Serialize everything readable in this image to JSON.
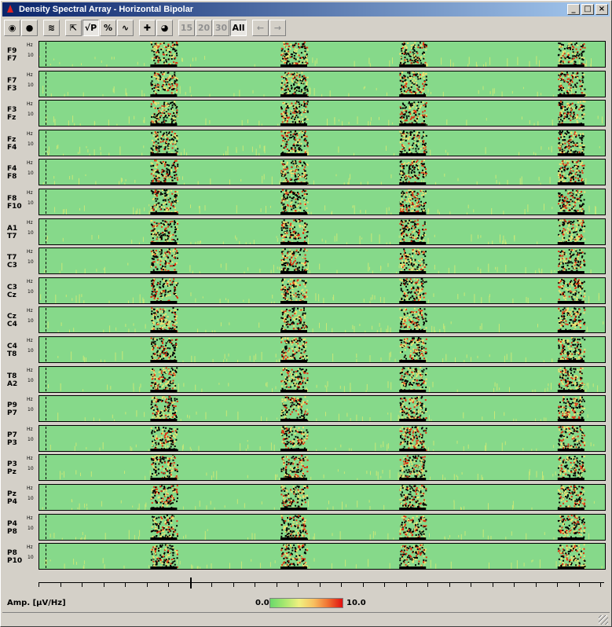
{
  "window": {
    "title": "Density Spectral Array - Horizontal Bipolar",
    "min_glyph": "_",
    "max_glyph": "□",
    "close_glyph": "×"
  },
  "toolbar": {
    "buttons": [
      {
        "name": "brain-view-button",
        "glyph": "◉",
        "state": "normal"
      },
      {
        "name": "topo-map-button",
        "glyph": "●",
        "state": "normal"
      },
      {
        "name": "waveform-button",
        "glyph": "≋",
        "state": "normal"
      },
      {
        "name": "fit-button",
        "glyph": "⇱",
        "state": "normal"
      },
      {
        "name": "sqrt-power-button",
        "glyph": "√P",
        "state": "pressed"
      },
      {
        "name": "percent-button",
        "glyph": "%",
        "state": "normal"
      },
      {
        "name": "trend-button",
        "glyph": "∿",
        "state": "normal"
      },
      {
        "name": "color-scale-button",
        "glyph": "✚",
        "state": "normal"
      },
      {
        "name": "head-map-button",
        "glyph": "◕",
        "state": "normal"
      },
      {
        "name": "range-15-button",
        "glyph": "15",
        "state": "disabled"
      },
      {
        "name": "range-20-button",
        "glyph": "20",
        "state": "disabled"
      },
      {
        "name": "range-30-button",
        "glyph": "30",
        "state": "disabled"
      },
      {
        "name": "range-all-button",
        "glyph": "All",
        "state": "pressed"
      },
      {
        "name": "back-button",
        "glyph": "←",
        "state": "disabled"
      },
      {
        "name": "forward-button",
        "glyph": "→",
        "state": "disabled"
      }
    ]
  },
  "axis": {
    "hz_label": "Hz",
    "ten_label": "10"
  },
  "channels": [
    [
      "F9",
      "F7"
    ],
    [
      "F7",
      "F3"
    ],
    [
      "F3",
      "Fz"
    ],
    [
      "Fz",
      "F4"
    ],
    [
      "F4",
      "F8"
    ],
    [
      "F8",
      "F10"
    ],
    [
      "A1",
      "T7"
    ],
    [
      "T7",
      "C3"
    ],
    [
      "C3",
      "Cz"
    ],
    [
      "Cz",
      "C4"
    ],
    [
      "C4",
      "T8"
    ],
    [
      "T8",
      "A2"
    ],
    [
      "P9",
      "P7"
    ],
    [
      "P7",
      "P3"
    ],
    [
      "P3",
      "Pz"
    ],
    [
      "Pz",
      "P4"
    ],
    [
      "P4",
      "P8"
    ],
    [
      "P8",
      "P10"
    ]
  ],
  "bursts": [
    0.22,
    0.45,
    0.66,
    0.94
  ],
  "footer": {
    "amp_label": "Amp. [μV/Hz]",
    "scale_min": "0.0",
    "scale_max": "10.0"
  },
  "colors": {
    "background": "#86d98a",
    "mid": "#f0e070",
    "high": "#e03010",
    "peak": "#000000"
  }
}
